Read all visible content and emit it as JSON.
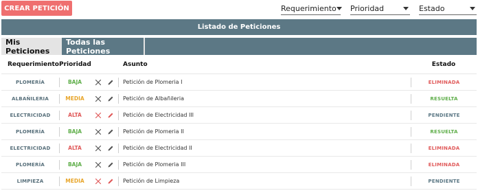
{
  "toolbar": {
    "create_label": "CREAR PETICIÓN"
  },
  "filters": {
    "requerimiento": "Requerimiento",
    "prioridad": "Prioridad",
    "estado": "Estado"
  },
  "list": {
    "title": "Listado de Peticiones",
    "tabs": [
      {
        "label": "Mis Peticiones"
      },
      {
        "label": "Todas las Peticiones"
      }
    ],
    "headers": {
      "requerimiento": "Requerimiento",
      "prioridad": "Prioridad",
      "asunto": "Asunto",
      "estado": "Estado"
    },
    "rows": [
      {
        "requerimiento": "PLOMERÍA",
        "prioridad": "BAJA",
        "asunto": "Petición de Plomeria I",
        "estado": "ELIMINADA",
        "actions_red": false
      },
      {
        "requerimiento": "ALBAÑILERIA",
        "prioridad": "MEDIA",
        "asunto": "Petición de Albañileria",
        "estado": "RESUELTA",
        "actions_red": false
      },
      {
        "requerimiento": "ELECTRICIDAD",
        "prioridad": "ALTA",
        "asunto": "Petición de Electricidad III",
        "estado": "PENDIENTE",
        "actions_red": true
      },
      {
        "requerimiento": "PLOMERÍA",
        "prioridad": "BAJA",
        "asunto": "Petición de Plomeria II",
        "estado": "RESUELTA",
        "actions_red": false
      },
      {
        "requerimiento": "ELECTRICIDAD",
        "prioridad": "ALTA",
        "asunto": "Petición de Electricidad II",
        "estado": "ELIMINADA",
        "actions_red": false
      },
      {
        "requerimiento": "PLOMERÍA",
        "prioridad": "BAJA",
        "asunto": "Petición de Plomeria III",
        "estado": "ELIMINADA",
        "actions_red": false
      },
      {
        "requerimiento": "LIMPIEZA",
        "prioridad": "MEDIA",
        "asunto": "Petición de Limpieza",
        "estado": "PENDIENTE",
        "actions_red": true
      }
    ]
  },
  "colors": {
    "accent": "#ef6f6f",
    "header_bg": "#5c7885",
    "baja": "#5fae4a",
    "media": "#e8a62c",
    "alta": "#e05a5a",
    "eliminada": "#e05a5a",
    "resuelta": "#5fae4a",
    "pendiente": "#5c7885",
    "action_gray": "#555555",
    "action_red": "#e05a5a"
  },
  "icons": {
    "delete": "close-icon",
    "edit": "pencil-icon",
    "dropdown": "chevron-down-icon"
  }
}
